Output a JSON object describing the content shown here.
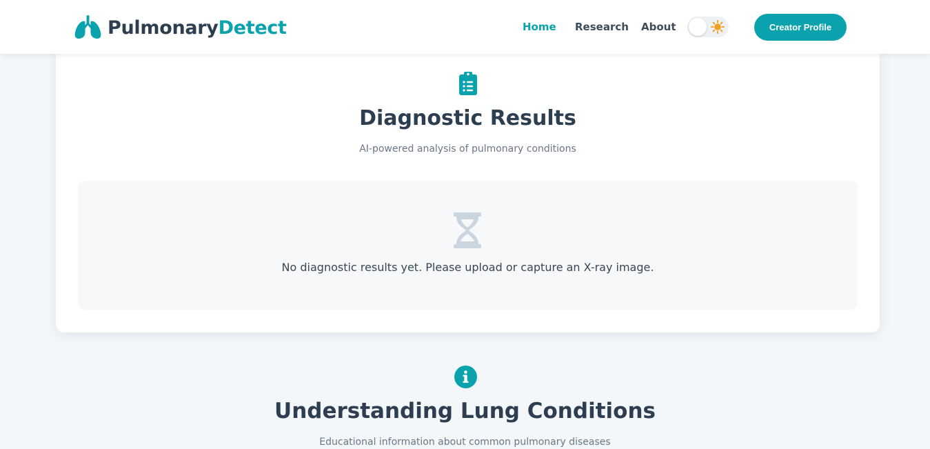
{
  "header": {
    "brand_part1": "Pulmonary",
    "brand_part2": "Detect",
    "logo_icon": "lungs-icon",
    "nav": {
      "home": "Home",
      "research": "Research",
      "about": "About"
    },
    "theme_toggle": {
      "state": "light",
      "icon": "sun-icon"
    },
    "creator_button": "Creator Profile"
  },
  "results": {
    "icon": "clipboard-list-icon",
    "title": "Diagnostic Results",
    "subtitle": "AI-powered analysis of pulmonary conditions",
    "empty_icon": "hourglass-icon",
    "empty_message": "No diagnostic results yet. Please upload or capture an X-ray image."
  },
  "conditions": {
    "icon": "info-circle-icon",
    "title": "Understanding Lung Conditions",
    "subtitle": "Educational information about common pulmonary diseases"
  },
  "colors": {
    "accent": "#0aa3ad",
    "heading": "#2c3e50",
    "page_bg": "#f4f7fa",
    "sun": "#f0a020"
  }
}
